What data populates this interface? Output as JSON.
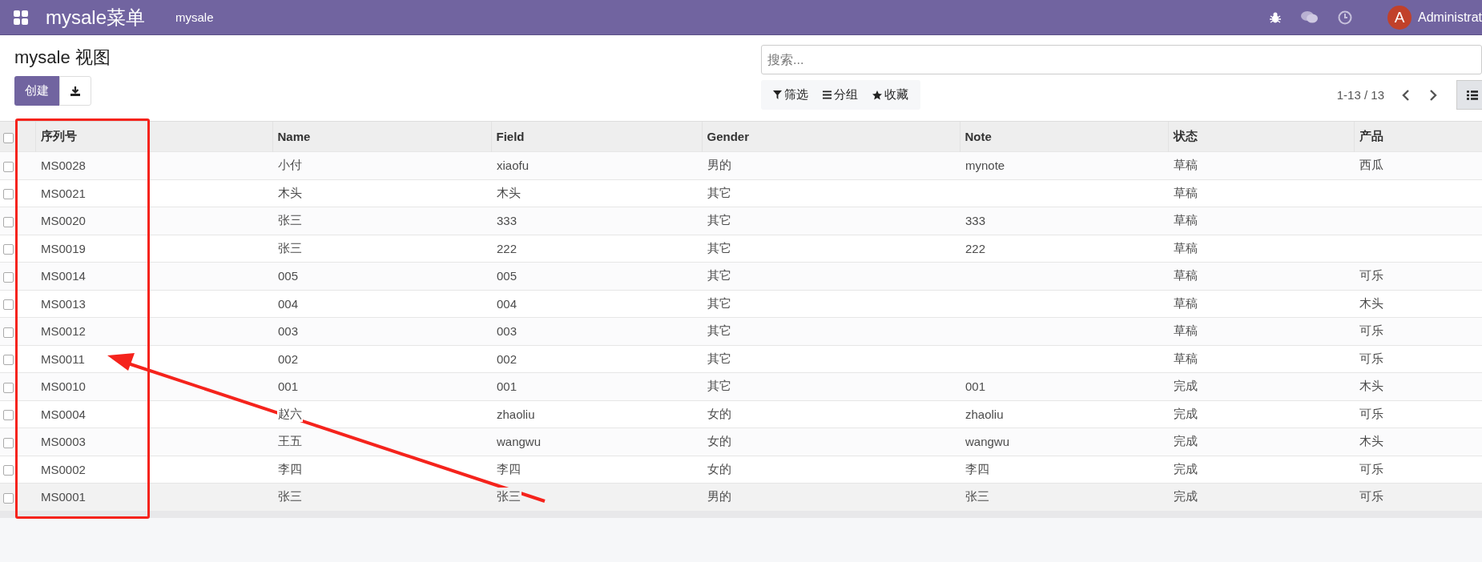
{
  "navbar": {
    "app_title": "mysale菜单",
    "menu": [
      "mysale"
    ],
    "user": {
      "initial": "A",
      "name": "Administrat"
    }
  },
  "page_title": "mysale 视图",
  "create_button": "创建",
  "search": {
    "placeholder": "搜索..."
  },
  "filters": [
    {
      "kind": "filter",
      "label": "筛选"
    },
    {
      "kind": "group",
      "label": "分组"
    },
    {
      "kind": "favorite",
      "label": "收藏"
    }
  ],
  "pager": "1-13 / 13",
  "table": {
    "select_all_checked": false,
    "columns": [
      "序列号",
      "Name",
      "Field",
      "Gender",
      "Note",
      "状态",
      "产品"
    ],
    "rows": [
      {
        "checked": false,
        "cells": [
          "MS0028",
          "小付",
          "xiaofu",
          "男的",
          "mynote",
          "草稿",
          "西瓜"
        ]
      },
      {
        "checked": false,
        "cells": [
          "MS0021",
          "木头",
          "木头",
          "其它",
          "",
          "草稿",
          ""
        ]
      },
      {
        "checked": false,
        "cells": [
          "MS0020",
          "张三",
          "333",
          "其它",
          "333",
          "草稿",
          ""
        ]
      },
      {
        "checked": false,
        "cells": [
          "MS0019",
          "张三",
          "222",
          "其它",
          "222",
          "草稿",
          ""
        ]
      },
      {
        "checked": false,
        "cells": [
          "MS0014",
          "005",
          "005",
          "其它",
          "",
          "草稿",
          "可乐"
        ]
      },
      {
        "checked": false,
        "cells": [
          "MS0013",
          "004",
          "004",
          "其它",
          "",
          "草稿",
          "木头"
        ]
      },
      {
        "checked": false,
        "cells": [
          "MS0012",
          "003",
          "003",
          "其它",
          "",
          "草稿",
          "可乐"
        ]
      },
      {
        "checked": false,
        "cells": [
          "MS0011",
          "002",
          "002",
          "其它",
          "",
          "草稿",
          "可乐"
        ]
      },
      {
        "checked": false,
        "cells": [
          "MS0010",
          "001",
          "001",
          "其它",
          "001",
          "完成",
          "木头"
        ]
      },
      {
        "checked": false,
        "cells": [
          "MS0004",
          "赵六",
          "zhaoliu",
          "女的",
          "zhaoliu",
          "完成",
          "可乐"
        ]
      },
      {
        "checked": false,
        "cells": [
          "MS0003",
          "王五",
          "wangwu",
          "女的",
          "wangwu",
          "完成",
          "木头"
        ]
      },
      {
        "checked": false,
        "cells": [
          "MS0002",
          "李四",
          "李四",
          "女的",
          "李四",
          "完成",
          "可乐"
        ]
      },
      {
        "checked": false,
        "cells": [
          "MS0001",
          "张三",
          "张三",
          "男的",
          "张三",
          "完成",
          "可乐"
        ]
      }
    ]
  }
}
